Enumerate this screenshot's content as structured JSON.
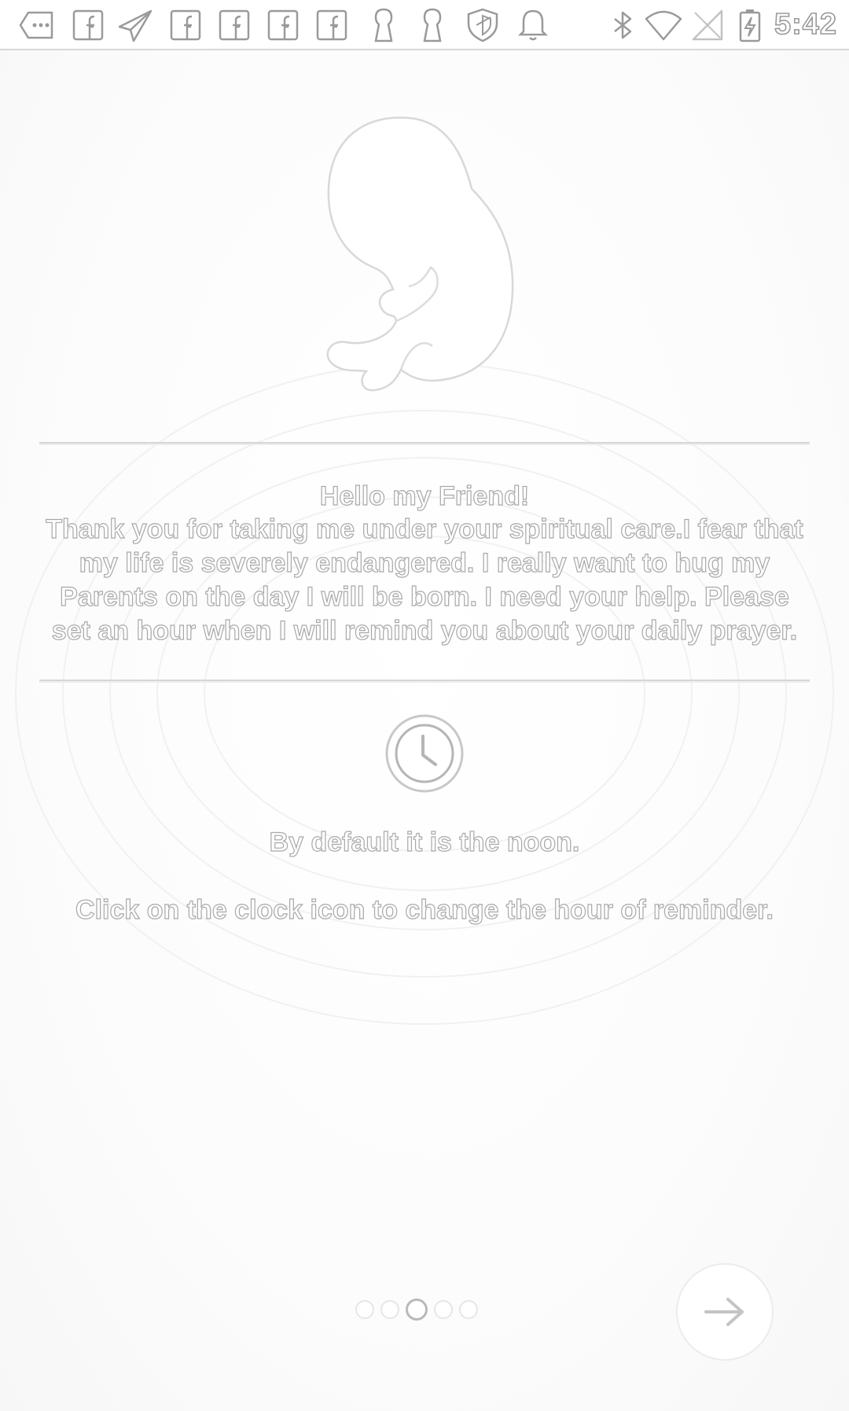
{
  "status_bar": {
    "time": "5:42",
    "notification_icons": [
      "more-icon",
      "facebook-icon",
      "send-icon",
      "facebook-icon",
      "facebook-icon",
      "facebook-icon",
      "facebook-icon",
      "keyhole-icon",
      "keyhole-icon",
      "shield-icon",
      "bell-icon"
    ],
    "system_icons": [
      "bluetooth-icon",
      "wifi-icon",
      "no-sim-icon",
      "battery-charging-icon"
    ]
  },
  "intro": {
    "greeting": "Hello my Friend!",
    "message": "Thank you for taking me under your spiritual care.I fear that my life is severely endangered. I really want to hug my Parents on the day I will be born. I need your help. Please set an hour when I will remind you about your daily prayer."
  },
  "reminder": {
    "clock_icon": "clock-icon",
    "default_text": "By default it is the noon.",
    "instruction_text": "Click on the clock icon to change the hour of reminder."
  },
  "pager": {
    "total_pages": 5,
    "current_page": 3
  },
  "navigation": {
    "next_icon": "arrow-right-icon"
  }
}
